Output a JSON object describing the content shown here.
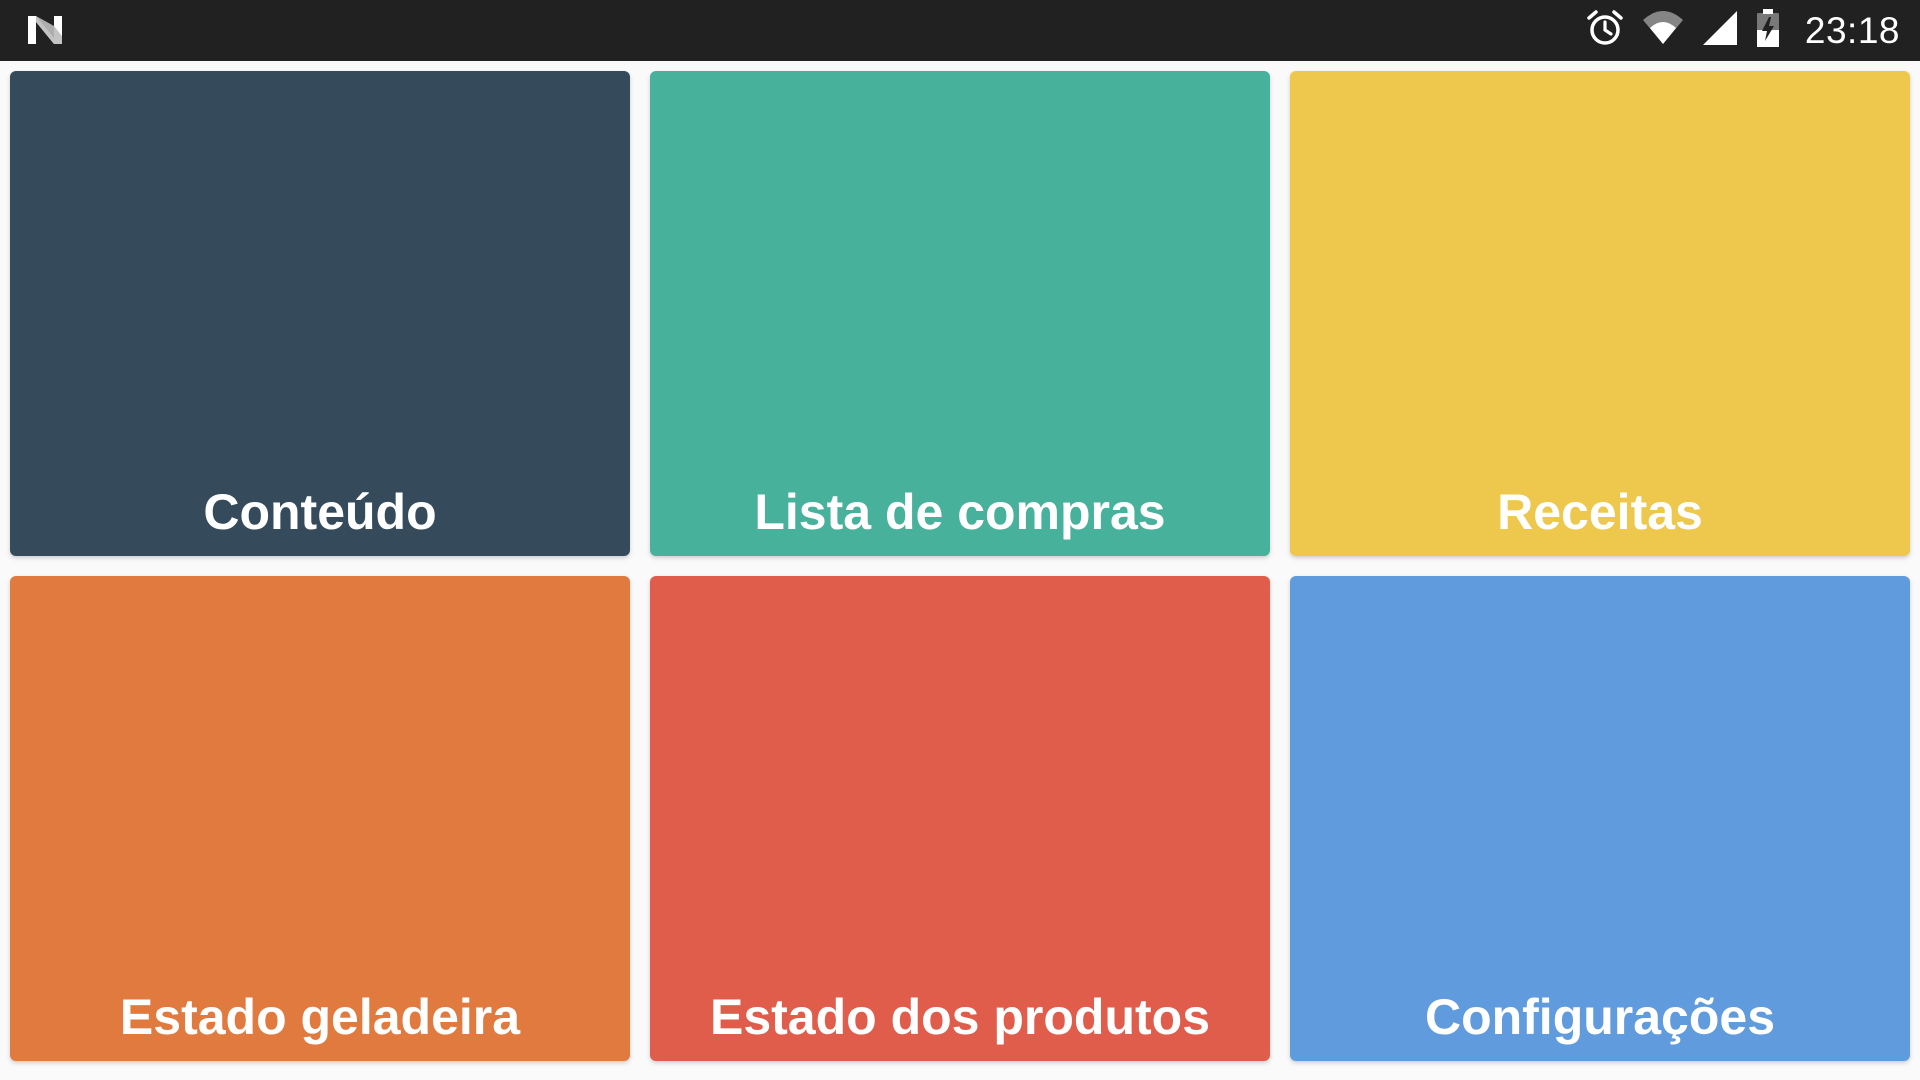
{
  "status_bar": {
    "time": "23:18",
    "icons": [
      "notification-n-icon",
      "alarm-icon",
      "wifi-icon",
      "cellular-signal-icon",
      "battery-charging-icon"
    ]
  },
  "tiles": [
    {
      "label": "Conteúdo",
      "color": "#354b5c"
    },
    {
      "label": "Lista de compras",
      "color": "#47b19c"
    },
    {
      "label": "Receitas",
      "color": "#edc84d"
    },
    {
      "label": "Estado geladeira",
      "color": "#e17a3f"
    },
    {
      "label": "Estado dos produtos",
      "color": "#e05c4b"
    },
    {
      "label": "Configurações",
      "color": "#609bde"
    }
  ]
}
